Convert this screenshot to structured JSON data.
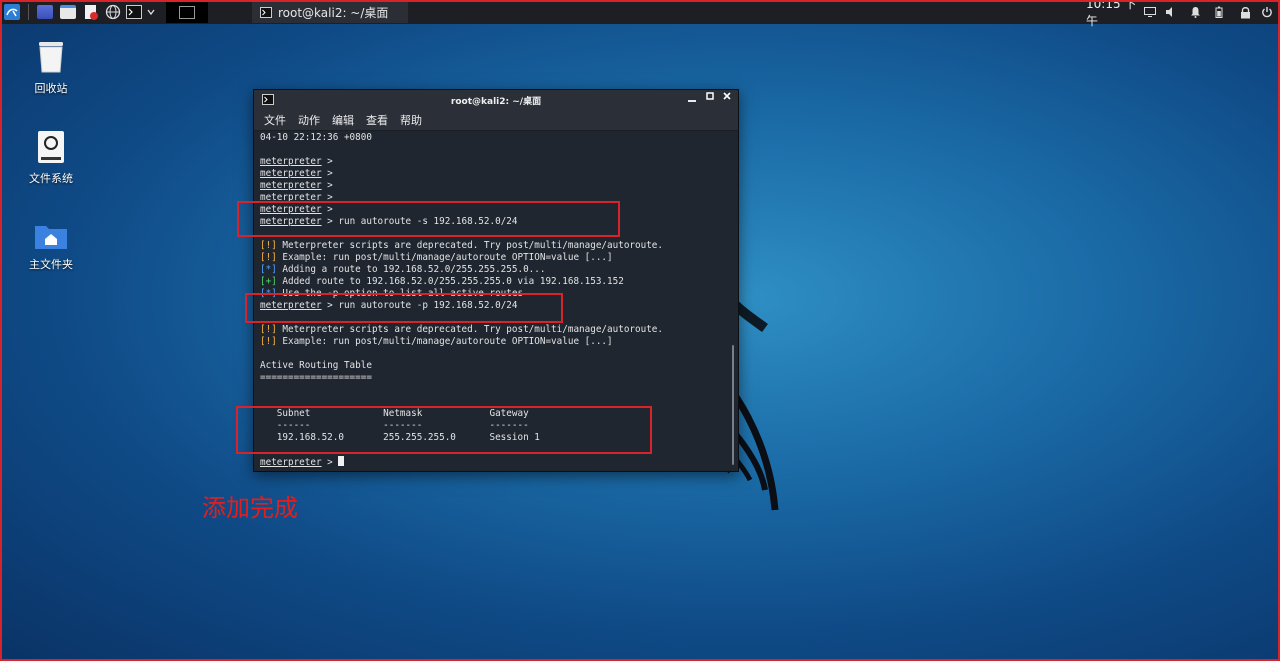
{
  "taskbar": {
    "task_terminal": "root@kali2: ~/桌面",
    "clock": "10:15 下午"
  },
  "desktop": {
    "icons": [
      {
        "label": "回收站",
        "icon": "trash-icon"
      },
      {
        "label": "文件系统",
        "icon": "drive-icon"
      },
      {
        "label": "主文件夹",
        "icon": "home-folder-icon"
      }
    ]
  },
  "terminal": {
    "title": "root@kali2: ~/桌面",
    "menu": [
      "文件",
      "动作",
      "编辑",
      "查看",
      "帮助"
    ],
    "lines": [
      {
        "prompt": "",
        "text": "04-10 22:12:36 +0800",
        "tag": "",
        "tagcls": ""
      },
      {
        "prompt": "",
        "text": "",
        "tag": "",
        "tagcls": ""
      },
      {
        "prompt": "meterpreter",
        "text": " >",
        "tag": "",
        "tagcls": ""
      },
      {
        "prompt": "meterpreter",
        "text": " >",
        "tag": "",
        "tagcls": ""
      },
      {
        "prompt": "meterpreter",
        "text": " >",
        "tag": "",
        "tagcls": ""
      },
      {
        "prompt": "meterpreter",
        "text": " >",
        "tag": "",
        "tagcls": ""
      },
      {
        "prompt": "meterpreter",
        "text": " >",
        "tag": "",
        "tagcls": ""
      },
      {
        "prompt": "meterpreter",
        "text": " > run autoroute -s 192.168.52.0/24",
        "tag": "",
        "tagcls": ""
      },
      {
        "prompt": "",
        "text": "",
        "tag": "",
        "tagcls": ""
      },
      {
        "prompt": "",
        "text": " Meterpreter scripts are deprecated. Try post/multi/manage/autoroute.",
        "tag": "[!]",
        "tagcls": "tag-warn"
      },
      {
        "prompt": "",
        "text": " Example: run post/multi/manage/autoroute OPTION=value [...]",
        "tag": "[!]",
        "tagcls": "tag-warn"
      },
      {
        "prompt": "",
        "text": " Adding a route to 192.168.52.0/255.255.255.0...",
        "tag": "[*]",
        "tagcls": "tag-info"
      },
      {
        "prompt": "",
        "text": " Added route to 192.168.52.0/255.255.255.0 via 192.168.153.152",
        "tag": "[+]",
        "tagcls": "tag-good"
      },
      {
        "prompt": "",
        "text": " Use the -p option to list all active routes",
        "tag": "[*]",
        "tagcls": "tag-info"
      },
      {
        "prompt": "meterpreter",
        "text": " > run autoroute -p 192.168.52.0/24",
        "tag": "",
        "tagcls": ""
      },
      {
        "prompt": "",
        "text": "",
        "tag": "",
        "tagcls": ""
      },
      {
        "prompt": "",
        "text": " Meterpreter scripts are deprecated. Try post/multi/manage/autoroute.",
        "tag": "[!]",
        "tagcls": "tag-warn"
      },
      {
        "prompt": "",
        "text": " Example: run post/multi/manage/autoroute OPTION=value [...]",
        "tag": "[!]",
        "tagcls": "tag-warn"
      },
      {
        "prompt": "",
        "text": "",
        "tag": "",
        "tagcls": ""
      },
      {
        "prompt": "",
        "text": "Active Routing Table",
        "tag": "",
        "tagcls": ""
      },
      {
        "prompt": "",
        "text": "====================",
        "tag": "",
        "tagcls": ""
      },
      {
        "prompt": "",
        "text": "",
        "tag": "",
        "tagcls": ""
      },
      {
        "prompt": "",
        "text": "",
        "tag": "",
        "tagcls": ""
      },
      {
        "prompt": "",
        "text": "   Subnet             Netmask            Gateway",
        "tag": "",
        "tagcls": ""
      },
      {
        "prompt": "",
        "text": "   ------             -------            -------",
        "tag": "",
        "tagcls": ""
      },
      {
        "prompt": "",
        "text": "   192.168.52.0       255.255.255.0      Session 1",
        "tag": "",
        "tagcls": ""
      },
      {
        "prompt": "",
        "text": "",
        "tag": "",
        "tagcls": ""
      },
      {
        "prompt": "meterpreter",
        "text": " > ",
        "tag": "",
        "tagcls": "",
        "cursor": true
      }
    ]
  },
  "annotation": {
    "text": "添加完成"
  },
  "colors": {
    "highlight_red": "#d9232a",
    "terminal_bg": "#202630",
    "warn": "#ffb43a",
    "info": "#4fa3ff",
    "good": "#4ad96b"
  }
}
